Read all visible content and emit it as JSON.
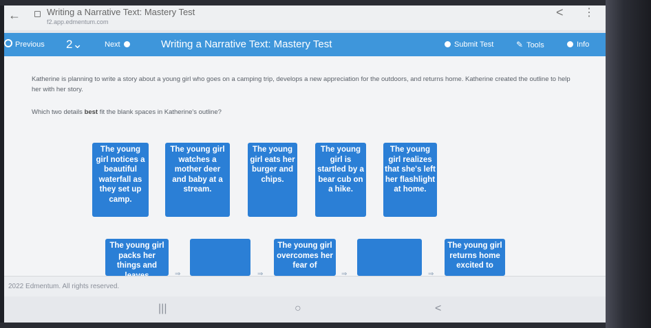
{
  "browser": {
    "back_glyph": "←",
    "tab_title": "Writing a Narrative Text: Mastery Test",
    "url": "f2.app.edmentum.com",
    "share_glyph": "<",
    "more_glyph": "⋮"
  },
  "toolbar": {
    "previous_label": "Previous",
    "question_number": "2⌄",
    "next_label": "Next",
    "heading": "Writing a Narrative Text: Mastery Test",
    "submit_label": "Submit Test",
    "tools_label": "Tools",
    "info_label": "Info",
    "bar_color": "#3e96db"
  },
  "question": {
    "prompt": "Katherine is planning to write a story about a young girl who goes on a camping trip, develops a new appreciation for the outdoors, and returns home. Katherine created the outline to help her with her story.",
    "ask_prefix": "Which two details ",
    "ask_bold": "best",
    "ask_suffix": " fit the blank spaces in Katherine's outline?"
  },
  "answer_tiles": [
    "The young girl notices a beautiful waterfall as they set up camp.",
    "The young girl watches a mother deer and baby at a stream.",
    "The young girl eats her burger and chips.",
    "The young girl is startled by a bear cub on a hike.",
    "The young girl realizes that she's left her flashlight at home."
  ],
  "outline": {
    "step1": "The young girl packs her things and leaves",
    "step3": "The young girl overcomes her fear of",
    "step5": "The young girl returns home excited to",
    "arrow_glyph": "⇒",
    "tile_color": "#2b7fd6"
  },
  "footer": {
    "copyright": "2022 Edmentum. All rights reserved."
  },
  "android_nav": {
    "recents_glyph": "|||",
    "home_glyph": "○",
    "back_glyph": "<"
  }
}
